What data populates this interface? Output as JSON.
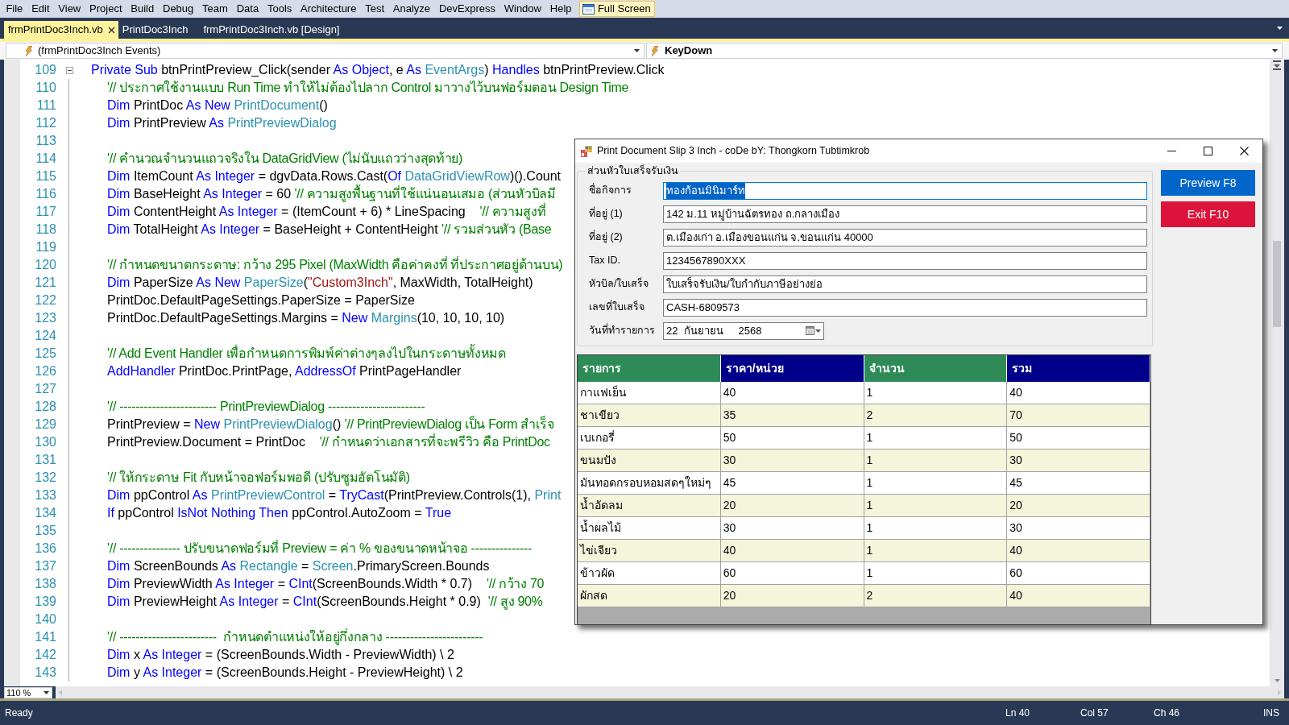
{
  "menu_bar": {
    "items": [
      "File",
      "Edit",
      "View",
      "Project",
      "Build",
      "Debug",
      "Team",
      "Data",
      "Tools",
      "Architecture",
      "Test",
      "Analyze",
      "DevExpress",
      "Window",
      "Help"
    ],
    "full_screen_button": {
      "label": "Full Screen",
      "on": true
    }
  },
  "tabs": [
    {
      "label": "frmPrintDoc3Inch.vb",
      "selected": true
    },
    {
      "label": "PrintDoc3Inch",
      "selected": false
    },
    {
      "label": "frmPrintDoc3Inch.vb [Design]",
      "selected": false
    }
  ],
  "navigation_bar": {
    "type_dropdown": "(frmPrintDoc3Inch Events)",
    "member_dropdown": "KeyDown"
  },
  "editor": {
    "zoom": "110 %",
    "lines": [
      {
        "number": "109",
        "expanded": true,
        "tokens": [
          {
            "kind": "keyword",
            "text": "Private Sub"
          },
          {
            "kind": "plain",
            "text": " btnPrintPreview_Click(sender "
          },
          {
            "kind": "keyword",
            "text": "As Object"
          },
          {
            "kind": "plain",
            "text": ", e "
          },
          {
            "kind": "keyword",
            "text": "As "
          },
          {
            "kind": "type",
            "text": "EventArgs"
          },
          {
            "kind": "plain",
            "text": ") "
          },
          {
            "kind": "keyword",
            "text": "Handles"
          },
          {
            "kind": "plain",
            "text": " btnPrintPreview.Click"
          }
        ],
        "children": [
          {
            "number": "110",
            "tokens": [
              {
                "kind": "comment",
                "text": "'// ประกาศใช้งานแบบ Run Time ทำให้ไม่ต้องไปลาก Control มาวางไว้บนฟอร์มตอน Design Time"
              }
            ]
          },
          {
            "number": "111",
            "tokens": [
              {
                "kind": "keyword",
                "text": "Dim"
              },
              {
                "kind": "plain",
                "text": " PrintDoc "
              },
              {
                "kind": "keyword",
                "text": "As New "
              },
              {
                "kind": "type",
                "text": "PrintDocument"
              },
              {
                "kind": "plain",
                "text": "()"
              }
            ]
          },
          {
            "number": "112",
            "tokens": [
              {
                "kind": "keyword",
                "text": "Dim"
              },
              {
                "kind": "plain",
                "text": " PrintPreview "
              },
              {
                "kind": "keyword",
                "text": "As "
              },
              {
                "kind": "type",
                "text": "PrintPreviewDialog"
              }
            ]
          },
          {
            "number": "113"
          },
          {
            "number": "114",
            "tokens": [
              {
                "kind": "comment",
                "text": "'// คำนวณจำนวนแถวจริงใน DataGridView (ไม่นับแถวว่างสุดท้าย)"
              }
            ]
          },
          {
            "number": "115",
            "tokens": [
              {
                "kind": "keyword",
                "text": "Dim"
              },
              {
                "kind": "plain",
                "text": " ItemCount "
              },
              {
                "kind": "keyword",
                "text": "As Integer"
              },
              {
                "kind": "plain",
                "text": " = dgvData.Rows.Cast("
              },
              {
                "kind": "keyword",
                "text": "Of "
              },
              {
                "kind": "type",
                "text": "DataGridViewRow"
              },
              {
                "kind": "plain",
                "text": ")().Count"
              }
            ]
          },
          {
            "number": "116",
            "tokens": [
              {
                "kind": "keyword",
                "text": "Dim"
              },
              {
                "kind": "plain",
                "text": " BaseHeight "
              },
              {
                "kind": "keyword",
                "text": "As Integer"
              },
              {
                "kind": "plain",
                "text": " = 60 "
              },
              {
                "kind": "comment",
                "text": "'// ความสูงพื้นฐานที่ใช้แน่นอนเสมอ (ส่วนหัวบิลมี"
              }
            ]
          },
          {
            "number": "117",
            "tokens": [
              {
                "kind": "keyword",
                "text": "Dim"
              },
              {
                "kind": "plain",
                "text": " ContentHeight "
              },
              {
                "kind": "keyword",
                "text": "As Integer"
              },
              {
                "kind": "plain",
                "text": " = (ItemCount + 6) * LineSpacing    "
              },
              {
                "kind": "comment",
                "text": "'// ความสูงที่"
              }
            ]
          },
          {
            "number": "118",
            "tokens": [
              {
                "kind": "keyword",
                "text": "Dim"
              },
              {
                "kind": "plain",
                "text": " TotalHeight "
              },
              {
                "kind": "keyword",
                "text": "As Integer"
              },
              {
                "kind": "plain",
                "text": " = BaseHeight + ContentHeight "
              },
              {
                "kind": "comment",
                "text": "'// รวมส่วนหัว (Base"
              }
            ]
          },
          {
            "number": "119"
          },
          {
            "number": "120",
            "tokens": [
              {
                "kind": "comment",
                "text": "'// กำหนดขนาดกระดาษ: กว้าง 295 Pixel (MaxWidth คือค่าคงที่ ที่ประกาศอยู่ด้านบน)"
              }
            ]
          },
          {
            "number": "121",
            "tokens": [
              {
                "kind": "keyword",
                "text": "Dim"
              },
              {
                "kind": "plain",
                "text": " PaperSize "
              },
              {
                "kind": "keyword",
                "text": "As New "
              },
              {
                "kind": "type",
                "text": "PaperSize"
              },
              {
                "kind": "plain",
                "text": "("
              },
              {
                "kind": "string",
                "text": "\"Custom3Inch\""
              },
              {
                "kind": "plain",
                "text": ", MaxWidth, TotalHeight)"
              }
            ]
          },
          {
            "number": "122",
            "tokens": [
              {
                "kind": "plain",
                "text": "PrintDoc.DefaultPageSettings.PaperSize = PaperSize"
              }
            ]
          },
          {
            "number": "123",
            "tokens": [
              {
                "kind": "plain",
                "text": "PrintDoc.DefaultPageSettings.Margins = "
              },
              {
                "kind": "keyword",
                "text": "New "
              },
              {
                "kind": "type",
                "text": "Margins"
              },
              {
                "kind": "plain",
                "text": "(10, 10, 10, 10)"
              }
            ]
          },
          {
            "number": "124"
          },
          {
            "number": "125",
            "tokens": [
              {
                "kind": "comment",
                "text": "'// Add Event Handler เพื่อกำหนดการพิมพ์ค่าต่างๆลงไปในกระดาษทั้งหมด"
              }
            ]
          },
          {
            "number": "126",
            "tokens": [
              {
                "kind": "keyword",
                "text": "AddHandler"
              },
              {
                "kind": "plain",
                "text": " PrintDoc.PrintPage, "
              },
              {
                "kind": "keyword",
                "text": "AddressOf"
              },
              {
                "kind": "plain",
                "text": " PrintPageHandler"
              }
            ]
          },
          {
            "number": "127"
          },
          {
            "number": "128",
            "tokens": [
              {
                "kind": "comment",
                "text": "'// ------------------------ PrintPreviewDialog ------------------------"
              }
            ]
          },
          {
            "number": "129",
            "tokens": [
              {
                "kind": "plain",
                "text": "PrintPreview = "
              },
              {
                "kind": "keyword",
                "text": "New "
              },
              {
                "kind": "type",
                "text": "PrintPreviewDialog"
              },
              {
                "kind": "plain",
                "text": "() "
              },
              {
                "kind": "comment",
                "text": "'// PrintPreviewDialog เป็น Form สำเร็จ"
              }
            ]
          },
          {
            "number": "130",
            "tokens": [
              {
                "kind": "plain",
                "text": "PrintPreview.Document = PrintDoc    "
              },
              {
                "kind": "comment",
                "text": "'// กำหนดว่าเอกสารที่จะพรีวิว คือ PrintDoc"
              }
            ]
          },
          {
            "number": "131"
          },
          {
            "number": "132",
            "tokens": [
              {
                "kind": "comment",
                "text": "'// ให้กระดาษ Fit กับหน้าจอฟอร์มพอดี (ปรับซูมอัตโนมัติ)"
              }
            ]
          },
          {
            "number": "133",
            "tokens": [
              {
                "kind": "keyword",
                "text": "Dim"
              },
              {
                "kind": "plain",
                "text": " ppControl "
              },
              {
                "kind": "keyword",
                "text": "As "
              },
              {
                "kind": "type",
                "text": "PrintPreviewControl"
              },
              {
                "kind": "plain",
                "text": " = "
              },
              {
                "kind": "keyword",
                "text": "TryCast"
              },
              {
                "kind": "plain",
                "text": "(PrintPreview.Controls(1), "
              },
              {
                "kind": "type",
                "text": "Print"
              }
            ]
          },
          {
            "number": "134",
            "tokens": [
              {
                "kind": "keyword",
                "text": "If"
              },
              {
                "kind": "plain",
                "text": " ppControl "
              },
              {
                "kind": "keyword",
                "text": "IsNot Nothing Then"
              },
              {
                "kind": "plain",
                "text": " ppControl.AutoZoom = "
              },
              {
                "kind": "keyword",
                "text": "True"
              }
            ]
          },
          {
            "number": "135"
          },
          {
            "number": "136",
            "tokens": [
              {
                "kind": "comment",
                "text": "'// --------------- ปรับขนาดฟอร์มที่ Preview = ค่า % ของขนาดหน้าจอ ---------------"
              }
            ]
          },
          {
            "number": "137",
            "tokens": [
              {
                "kind": "keyword",
                "text": "Dim"
              },
              {
                "kind": "plain",
                "text": " ScreenBounds "
              },
              {
                "kind": "keyword",
                "text": "As "
              },
              {
                "kind": "type",
                "text": "Rectangle"
              },
              {
                "kind": "plain",
                "text": " = "
              },
              {
                "kind": "type",
                "text": "Screen"
              },
              {
                "kind": "plain",
                "text": ".PrimaryScreen.Bounds"
              }
            ]
          },
          {
            "number": "138",
            "tokens": [
              {
                "kind": "keyword",
                "text": "Dim"
              },
              {
                "kind": "plain",
                "text": " PreviewWidth "
              },
              {
                "kind": "keyword",
                "text": "As Integer"
              },
              {
                "kind": "plain",
                "text": " = "
              },
              {
                "kind": "keyword",
                "text": "CInt"
              },
              {
                "kind": "plain",
                "text": "(ScreenBounds.Width * 0.7)    "
              },
              {
                "kind": "comment",
                "text": "'// กว้าง 70"
              }
            ]
          },
          {
            "number": "139",
            "tokens": [
              {
                "kind": "keyword",
                "text": "Dim"
              },
              {
                "kind": "plain",
                "text": " PreviewHeight "
              },
              {
                "kind": "keyword",
                "text": "As Integer"
              },
              {
                "kind": "plain",
                "text": " = "
              },
              {
                "kind": "keyword",
                "text": "CInt"
              },
              {
                "kind": "plain",
                "text": "(ScreenBounds.Height * 0.9)  "
              },
              {
                "kind": "comment",
                "text": "'// สูง 90%"
              }
            ]
          },
          {
            "number": "140"
          },
          {
            "number": "141",
            "tokens": [
              {
                "kind": "comment",
                "text": "'// ------------------------  กำหนดตำแหน่งให้อยู่กึ่งกลาง ------------------------"
              }
            ]
          },
          {
            "number": "142",
            "tokens": [
              {
                "kind": "keyword",
                "text": "Dim"
              },
              {
                "kind": "plain",
                "text": " x "
              },
              {
                "kind": "keyword",
                "text": "As Integer"
              },
              {
                "kind": "plain",
                "text": " = (ScreenBounds.Width - PreviewWidth) \\ 2"
              }
            ]
          },
          {
            "number": "143",
            "tokens": [
              {
                "kind": "keyword",
                "text": "Dim"
              },
              {
                "kind": "plain",
                "text": " y "
              },
              {
                "kind": "keyword",
                "text": "As Integer"
              },
              {
                "kind": "plain",
                "text": " = (ScreenBounds.Height - PreviewHeight) \\ 2"
              }
            ]
          }
        ]
      }
    ]
  },
  "dialog": {
    "title": "Print Document Slip 3 Inch - coDe bY: Thongkorn Tubtimkrob",
    "group_title": "ส่วนหัวใบเสร็จรับเงิน",
    "fields": [
      {
        "kind": "text",
        "label": "ชื่อกิจการ",
        "value": "ทองก้อนมินิมาร์ท",
        "focused": true
      },
      {
        "kind": "text",
        "label": "ที่อยู่ (1)",
        "value": "142 ม.11 หมู่บ้านฉัตรทอง ถ.กลางเมือง",
        "focused": false
      },
      {
        "kind": "text",
        "label": "ที่อยู่ (2)",
        "value": "ต.เมืองเก่า อ.เมืองขอนแก่น จ.ขอนแก่น 40000",
        "focused": false
      },
      {
        "kind": "text",
        "label": "Tax ID.",
        "value": "1234567890XXX",
        "focused": false
      },
      {
        "kind": "text",
        "label": "หัวบิล/ใบเสร็จ",
        "value": "ใบเสร็จรับเงิน/ใบกำกับภาษีอย่างย่อ",
        "focused": false
      },
      {
        "kind": "text",
        "label": "เลขที่ใบเสร็จ",
        "value": "CASH-6809573",
        "focused": false
      },
      {
        "kind": "date",
        "label": "วันที่ทำรายการ",
        "day": "22",
        "month": "กันยายน",
        "year": "2568",
        "focused": false
      }
    ],
    "buttons": [
      {
        "label": "Preview F8",
        "color": "#0066cc"
      },
      {
        "label": "Exit F10",
        "color": "#dc143c"
      }
    ],
    "grid": {
      "columns": [
        {
          "label": "รายการ",
          "color": "#2e8b57"
        },
        {
          "label": "ราคา/หน่วย",
          "color": "#00008b"
        },
        {
          "label": "จำนวน",
          "color": "#2e8b57"
        },
        {
          "label": "รวม",
          "color": "#00008b"
        }
      ],
      "rows": [
        [
          "กาแฟเย็น",
          "40",
          "1",
          "40"
        ],
        [
          "ชาเขียว",
          "35",
          "2",
          "70"
        ],
        [
          "เบเกอรี่",
          "50",
          "1",
          "50"
        ],
        [
          "ขนมปัง",
          "30",
          "1",
          "30"
        ],
        [
          "มันทอดกรอบหอมสดๆใหม่ๆ",
          "45",
          "1",
          "45"
        ],
        [
          "น้ำอัดลม",
          "20",
          "1",
          "20"
        ],
        [
          "น้ำผลไม้",
          "30",
          "1",
          "30"
        ],
        [
          "ไข่เจียว",
          "40",
          "1",
          "40"
        ],
        [
          "ข้าวผัด",
          "60",
          "1",
          "60"
        ],
        [
          "ผักสด",
          "20",
          "2",
          "40"
        ]
      ]
    }
  },
  "status_bar": {
    "message": "Ready",
    "line": "Ln 40",
    "column": "Col 57",
    "character": "Ch 46",
    "mode": "INS"
  }
}
